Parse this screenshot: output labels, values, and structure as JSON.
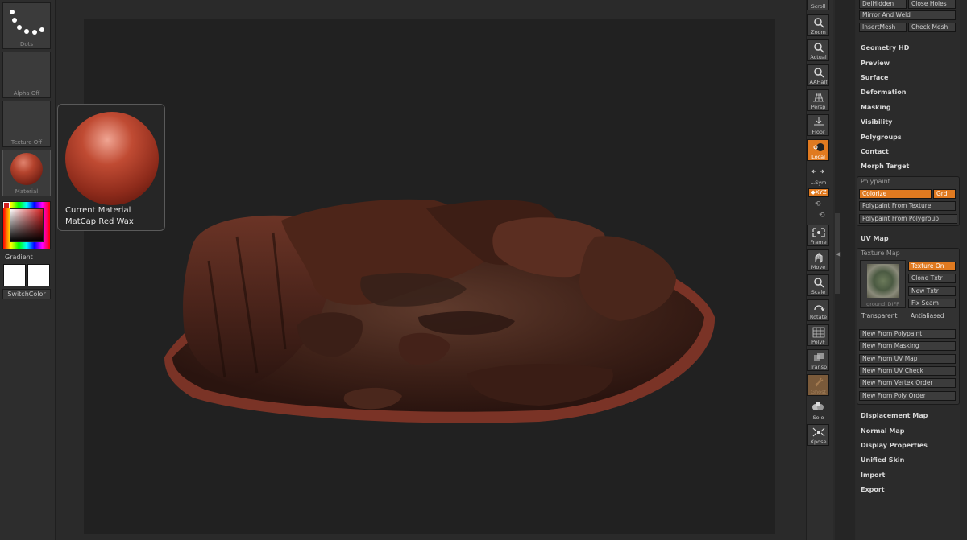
{
  "left_shelf": {
    "brush_label": "Dots",
    "alpha_label": "Alpha Off",
    "texture_label": "Texture Off",
    "material_label": "Material",
    "gradient_label": "Gradient",
    "switch_color_label": "SwitchColor",
    "main_color": "#d42020"
  },
  "material_popup": {
    "line1": "Current Material",
    "line2": "MatCap Red Wax"
  },
  "right_shelf": {
    "buttons": [
      "Scroll",
      "Zoom",
      "Actual",
      "AAHalf",
      "Persp",
      "Floor",
      "Local",
      "L.Sym",
      "Frame",
      "Move",
      "Scale",
      "Rotate",
      "PolyF",
      "Transp",
      "Ghost",
      "Solo",
      "Xpose"
    ],
    "xyz_label": "◆XYZ"
  },
  "palette": {
    "top_buttons": [
      "DelHidden",
      "Close Holes",
      "Mirror And Weld",
      "InsertMesh",
      "Check Mesh"
    ],
    "sections_a": [
      "Geometry HD",
      "Preview",
      "Surface",
      "Deformation",
      "Masking",
      "Visibility",
      "Polygroups",
      "Contact",
      "Morph Target"
    ],
    "polypaint": {
      "title": "Polypaint",
      "colorize": "Colorize",
      "grd": "Grd",
      "from_texture": "Polypaint From Texture",
      "from_polygroup": "Polypaint From Polygroup"
    },
    "uv_map": "UV Map",
    "texture_map": {
      "title": "Texture Map",
      "thumb_label": "ground_DIFF",
      "texture_on": "Texture On",
      "clone": "Clone Txtr",
      "new": "New Txtr",
      "fix_seam": "Fix Seam",
      "transparent": "Transparent",
      "antialiased": "Antialiased",
      "new_from": [
        "New From Polypaint",
        "New From Masking",
        "New From UV Map",
        "New From UV Check",
        "New From Vertex Order",
        "New From Poly Order"
      ]
    },
    "sections_b": [
      "Displacement Map",
      "Normal Map",
      "Display Properties",
      "Unified Skin",
      "Import",
      "Export"
    ]
  }
}
